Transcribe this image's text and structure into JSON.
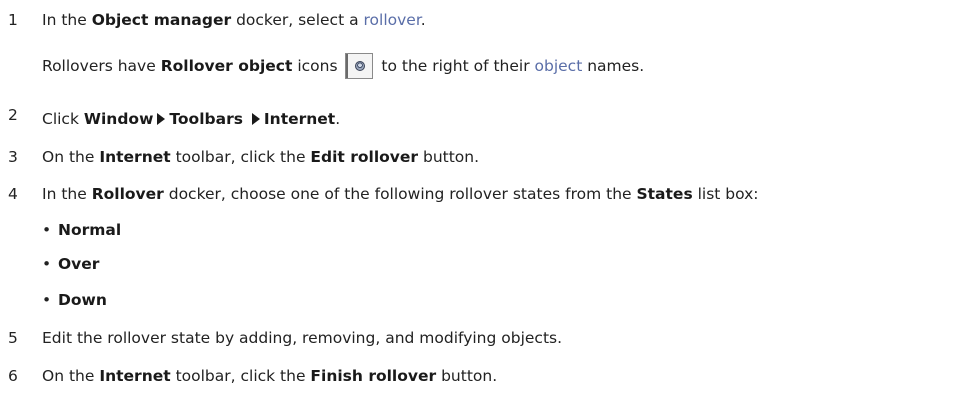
{
  "steps": [
    {
      "num": "1",
      "parts": [
        "In the ",
        "Object manager",
        " docker, select a ",
        "rollover",
        "."
      ]
    },
    {
      "sub": [
        "Rollovers have ",
        "Rollover object",
        " icons",
        "to the right of their ",
        "object",
        " names."
      ]
    },
    {
      "num": "2",
      "parts": [
        "Click ",
        "Window",
        "Toolbars",
        "Internet",
        "."
      ]
    },
    {
      "num": "3",
      "parts": [
        "On the ",
        "Internet",
        " toolbar, click the ",
        "Edit rollover",
        " button."
      ]
    },
    {
      "num": "4",
      "parts": [
        "In the ",
        "Rollover",
        " docker, choose one of the following rollover states from the ",
        "States",
        " list box:"
      ]
    },
    {
      "num": "5",
      "text": "Edit the rollover state by adding, removing, and modifying objects."
    },
    {
      "num": "6",
      "parts": [
        "On the ",
        "Internet",
        " toolbar, click the ",
        "Finish rollover",
        " button."
      ]
    }
  ],
  "bullets": [
    "Normal",
    "Over",
    "Down"
  ],
  "bullet_char": "•",
  "icons": {
    "rollover_object": "rollover-object-icon",
    "arrow": "menu-arrow-icon"
  },
  "colors": {
    "link": "#5a6ea8",
    "text": "#222222"
  }
}
